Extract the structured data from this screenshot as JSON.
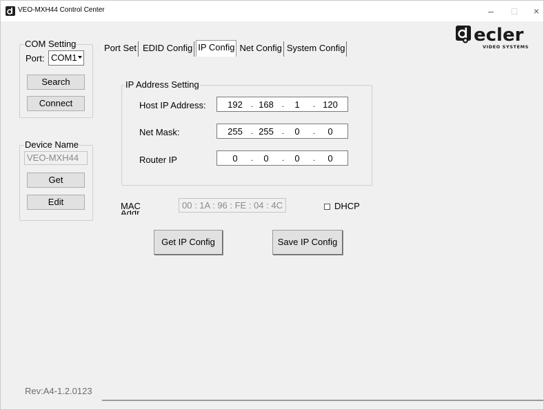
{
  "window": {
    "title": "VEO-MXH44 Control Center",
    "controls": {
      "minimize": "–",
      "maximize": "□",
      "close": "×"
    }
  },
  "com_setting": {
    "group_label": "COM Setting",
    "port_label": "Port:",
    "port_value": "COM1",
    "search_label": "Search",
    "connect_label": "Connect"
  },
  "device_name": {
    "group_label": "Device Name",
    "value": "VEO-MXH44",
    "get_label": "Get",
    "edit_label": "Edit"
  },
  "revision": "Rev:A4-1.2.0123",
  "tabs": [
    {
      "label": "Port Set"
    },
    {
      "label": "EDID Config"
    },
    {
      "label": "IP Config",
      "active": true
    },
    {
      "label": "Net Config"
    },
    {
      "label": "System Config"
    }
  ],
  "ip_settings": {
    "group_label": "IP Address Setting",
    "host_ip_label": "Host IP Address:",
    "host_ip": [
      "192",
      "168",
      "1",
      "120"
    ],
    "net_mask_label": "Net Mask:",
    "net_mask": [
      "255",
      "255",
      "0",
      "0"
    ],
    "router_ip_label": "Router IP",
    "router_ip": [
      "0",
      "0",
      "0",
      "0"
    ],
    "separator": "."
  },
  "mac": {
    "label": "MAC",
    "sublabel": "Addr",
    "value": "00 : 1A : 96 : FE : 04 : 4C"
  },
  "dhcp": {
    "label": "DHCP",
    "checked": false
  },
  "actions": {
    "get_ip_config_label": "Get IP Config",
    "save_ip_config_label": "Save IP Config"
  },
  "logo": {
    "brand": "ecler",
    "tagline": "VIDEO SYSTEMS"
  }
}
